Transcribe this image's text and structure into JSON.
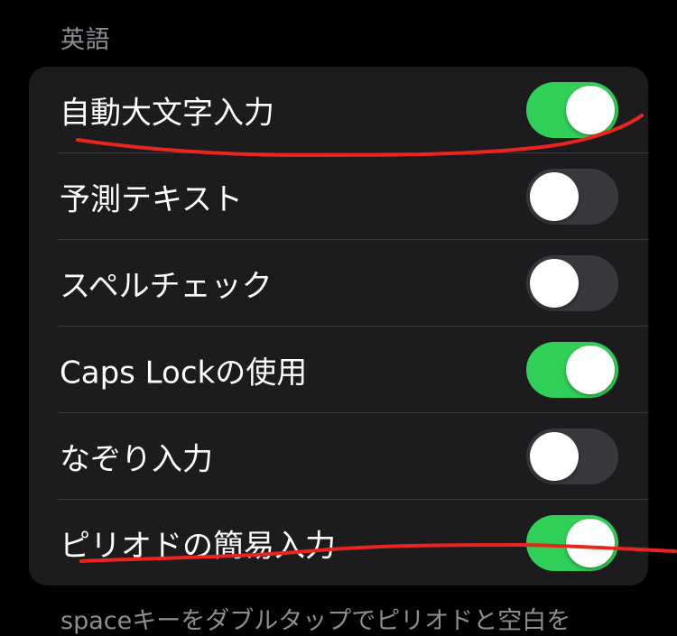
{
  "section": {
    "header": "英語"
  },
  "rows": [
    {
      "label": "自動大文字入力",
      "on": true
    },
    {
      "label": "予測テキスト",
      "on": false
    },
    {
      "label": "スペルチェック",
      "on": false
    },
    {
      "label": "Caps Lockの使用",
      "on": true
    },
    {
      "label": "なぞり入力",
      "on": false
    },
    {
      "label": "ピリオドの簡易入力",
      "on": true
    }
  ],
  "footer": {
    "text": "spaceキーをダブルタップでピリオドと空白を"
  },
  "colors": {
    "toggle_on": "#30d158",
    "toggle_off": "#39393d",
    "annotation": "#e8261e"
  }
}
